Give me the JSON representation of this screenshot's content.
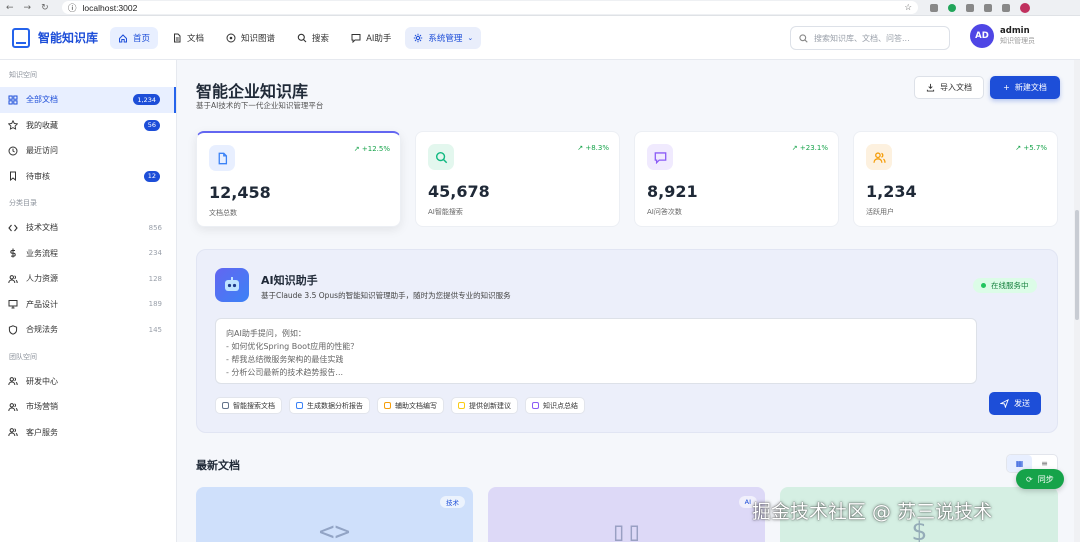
{
  "browser": {
    "url": "localhost:3002"
  },
  "app": {
    "name": "智能知识库"
  },
  "nav": [
    {
      "label": "首页",
      "icon": "home-icon",
      "active": true
    },
    {
      "label": "文档",
      "icon": "document-icon"
    },
    {
      "label": "知识图谱",
      "icon": "graph-icon"
    },
    {
      "label": "搜索",
      "icon": "search-icon"
    },
    {
      "label": "AI助手",
      "icon": "chat-icon"
    },
    {
      "label": "系统管理",
      "icon": "settings-icon"
    }
  ],
  "search": {
    "placeholder": "搜索知识库、文档、问答..."
  },
  "user": {
    "initials": "AD",
    "name": "admin",
    "role": "知识管理员"
  },
  "sidebar": {
    "sections": [
      {
        "title": "知识空间",
        "items": [
          {
            "label": "全部文档",
            "badge": "1,234",
            "icon": "grid-icon",
            "active": true
          },
          {
            "label": "我的收藏",
            "badge": "56",
            "icon": "star-icon"
          },
          {
            "label": "最近访问",
            "icon": "clock-icon"
          },
          {
            "label": "待审核",
            "badge": "12",
            "icon": "bookmark-icon"
          }
        ]
      },
      {
        "title": "分类目录",
        "items": [
          {
            "label": "技术文档",
            "count": "856",
            "icon": "code-icon"
          },
          {
            "label": "业务流程",
            "count": "234",
            "icon": "dollar-icon"
          },
          {
            "label": "人力资源",
            "count": "128",
            "icon": "users-icon"
          },
          {
            "label": "产品设计",
            "count": "189",
            "icon": "monitor-icon"
          },
          {
            "label": "合规法务",
            "count": "145",
            "icon": "shield-icon"
          }
        ]
      },
      {
        "title": "团队空间",
        "items": [
          {
            "label": "研发中心",
            "icon": "team-icon"
          },
          {
            "label": "市场营销",
            "icon": "team-icon"
          },
          {
            "label": "客户服务",
            "icon": "team-icon"
          }
        ]
      }
    ]
  },
  "page": {
    "title": "智能企业知识库",
    "subtitle": "基于AI技术的下一代企业知识管理平台",
    "import_label": "导入文档",
    "new_label": "新建文档"
  },
  "stats": [
    {
      "value": "12,458",
      "label": "文档总数",
      "trend": "+12.5%",
      "icon": "file-icon",
      "color": "#3b82f6",
      "bg": "#e8efff"
    },
    {
      "value": "45,678",
      "label": "AI智能搜索",
      "trend": "+8.3%",
      "icon": "search-icon",
      "color": "#10b981",
      "bg": "#e3f7ee"
    },
    {
      "value": "8,921",
      "label": "AI问答次数",
      "trend": "+23.1%",
      "icon": "chat-icon",
      "color": "#8b5cf6",
      "bg": "#f0eafe"
    },
    {
      "value": "1,234",
      "label": "活跃用户",
      "trend": "+5.7%",
      "icon": "users-icon",
      "color": "#f59e0b",
      "bg": "#fdf1df"
    }
  ],
  "ai": {
    "title": "AI知识助手",
    "subtitle": "基于Claude 3.5 Opus的智能知识管理助手，随时为您提供专业的知识服务",
    "status": "在线服务中",
    "placeholder": "向AI助手提问，例如：\n- 如何优化Spring Boot应用的性能？\n- 帮我总结微服务架构的最佳实践\n- 分析公司最新的技术趋势报告...",
    "chips": [
      {
        "label": "智能搜索文档",
        "color": "#64748b"
      },
      {
        "label": "生成数据分析报告",
        "color": "#3b82f6"
      },
      {
        "label": "辅助文档编写",
        "color": "#f59e0b"
      },
      {
        "label": "提供创新建议",
        "color": "#facc15"
      },
      {
        "label": "知识点总结",
        "color": "#8b5cf6"
      }
    ],
    "send_label": "发送"
  },
  "recent": {
    "title": "最新文档"
  },
  "docs": [
    {
      "tag": "技术",
      "glyph": "<>",
      "bg": "#cfe0fb"
    },
    {
      "tag": "AI",
      "glyph": "▯▯",
      "bg": "#ddd9f7"
    },
    {
      "tag": "",
      "glyph": "$",
      "bg": "#d5efe3"
    }
  ],
  "sync": {
    "label": "同步"
  },
  "watermark": "掘金技术社区 @ 苏三说技术"
}
